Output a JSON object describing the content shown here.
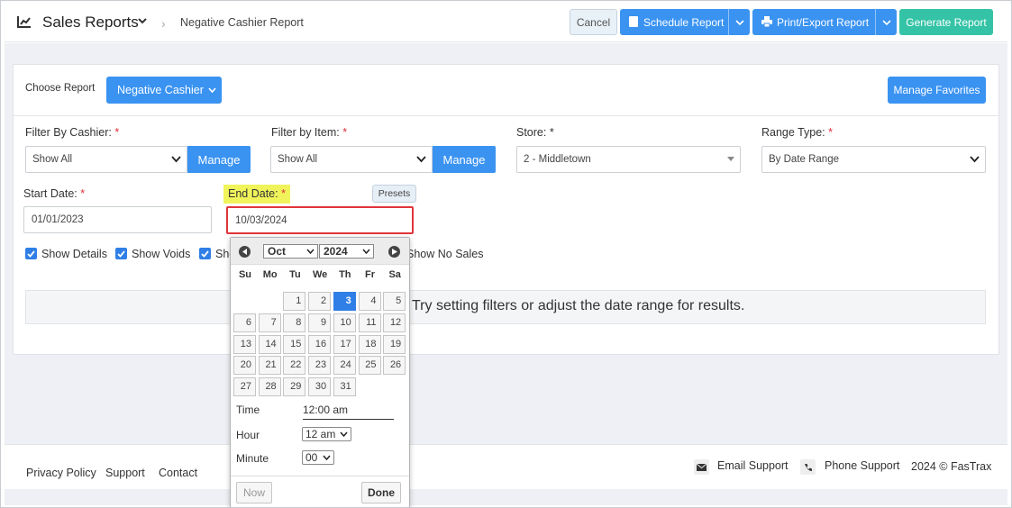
{
  "header": {
    "title": "Sales Reports",
    "breadcrumb": "Negative Cashier Report",
    "cancel": "Cancel",
    "schedule": "Schedule Report",
    "print": "Print/Export Report",
    "generate": "Generate Report"
  },
  "report": {
    "choose_label": "Choose Report",
    "selected": "Negative Cashier",
    "manage_favorites": "Manage Favorites"
  },
  "filters": {
    "cashier_label": "Filter By Cashier:",
    "cashier_value": "Show All",
    "item_label": "Filter by Item:",
    "item_value": "Show All",
    "manage": "Manage",
    "store_label": "Store:",
    "store_value": "2 - Middletown",
    "range_label": "Range Type:",
    "range_value": "By Date Range",
    "required": "*"
  },
  "dates": {
    "start_label": "Start Date:",
    "start_value": "01/01/2023",
    "end_label": "End Date:",
    "end_value": "10/03/2024",
    "presets": "Presets"
  },
  "checks": {
    "details": "Show Details",
    "voids": "Show Voids",
    "partial": "Sho",
    "no_sales": "Show No Sales"
  },
  "message": "Try setting filters or adjust the date range for results.",
  "calendar": {
    "month": "Oct",
    "year": "2024",
    "weekdays": [
      "Su",
      "Mo",
      "Tu",
      "We",
      "Th",
      "Fr",
      "Sa"
    ],
    "days": [
      "1",
      "2",
      "3",
      "4",
      "5",
      "6",
      "7",
      "8",
      "9",
      "10",
      "11",
      "12",
      "13",
      "14",
      "15",
      "16",
      "17",
      "18",
      "19",
      "20",
      "21",
      "22",
      "23",
      "24",
      "25",
      "26",
      "27",
      "28",
      "29",
      "30",
      "31"
    ],
    "selected_day": "3",
    "time_label": "Time",
    "time_value": "12:00 am",
    "hour_label": "Hour",
    "hour_value": "12 am",
    "minute_label": "Minute",
    "minute_value": "00",
    "now": "Now",
    "done": "Done"
  },
  "footer": {
    "privacy": "Privacy Policy",
    "support": "Support",
    "contact": "Contact",
    "email_support": "Email Support",
    "phone_support": "Phone Support",
    "copyright": "2024 © FasTrax"
  },
  "colors": {
    "primary": "#3a93f1",
    "generate": "#34c3a6",
    "highlight": "#f0f45a",
    "focus_border": "#e0353a",
    "required": "#e0303a"
  }
}
